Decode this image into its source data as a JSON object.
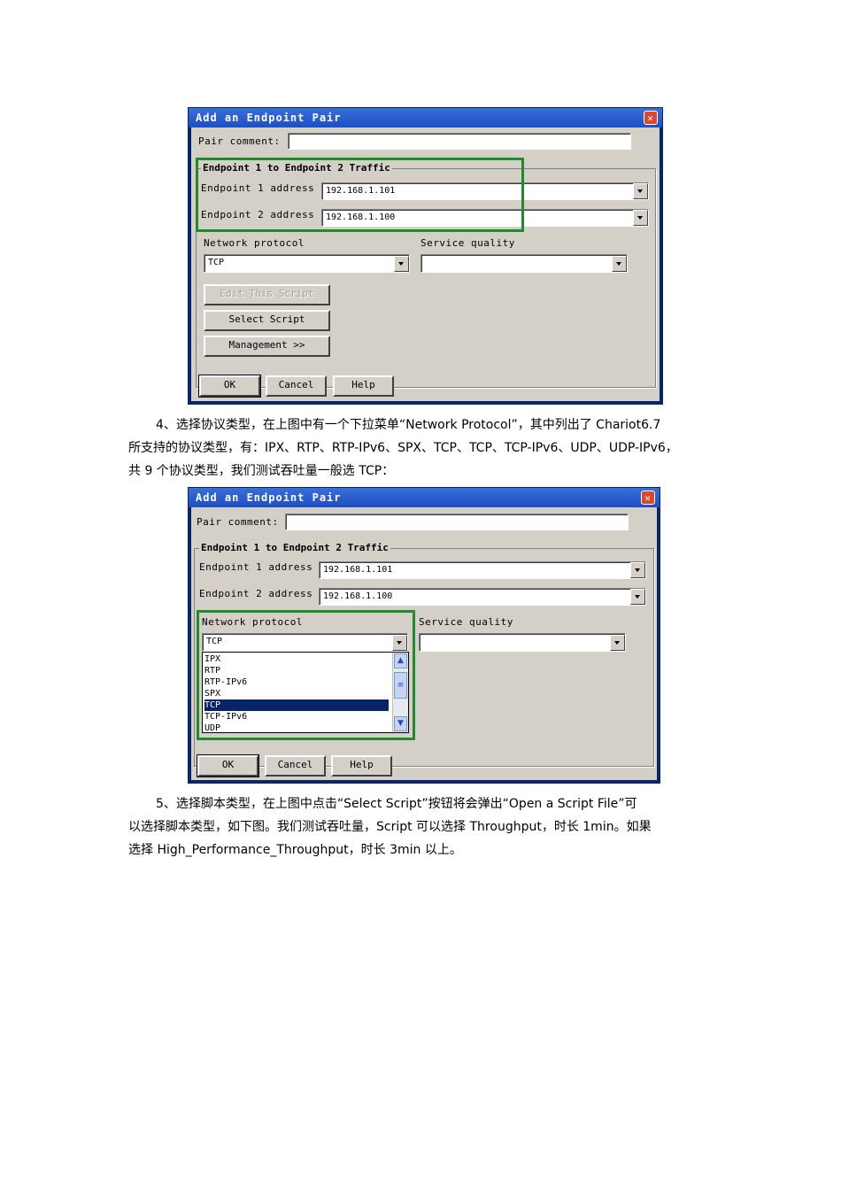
{
  "dialog1": {
    "title": "Add an Endpoint Pair",
    "pair_comment_label": "Pair comment:",
    "pair_comment_value": "",
    "group_title": "Endpoint 1 to Endpoint 2 Traffic",
    "ep1_label": "Endpoint 1 address",
    "ep1_value": "192.168.1.101",
    "ep2_label": "Endpoint 2 address",
    "ep2_value": "192.168.1.100",
    "protocol_label": "Network protocol",
    "protocol_value": "TCP",
    "quality_label": "Service quality",
    "quality_value": "",
    "edit_script": "Edit This Script",
    "select_script": "Select Script",
    "management": "Management >>",
    "ok": "OK",
    "cancel": "Cancel",
    "help": "Help"
  },
  "paragraph4": {
    "line1": "4、选择协议类型，在上图中有一个下拉菜单“Network Protocol”，其中列出了 Chariot6.7",
    "line2": "所支持的协议类型，有：IPX、RTP、RTP-IPv6、SPX、TCP、TCP、TCP-IPv6、UDP、UDP-IPv6，",
    "line3": "共 9 个协议类型，我们测试吞吐量一般选 TCP："
  },
  "dialog2": {
    "title": "Add an Endpoint Pair",
    "pair_comment_label": "Pair comment:",
    "group_title": "Endpoint 1 to Endpoint 2 Traffic",
    "ep1_label": "Endpoint 1 address",
    "ep1_value": "192.168.1.101",
    "ep2_label": "Endpoint 2 address",
    "ep2_value": "192.168.1.100",
    "protocol_label": "Network protocol",
    "protocol_value": "TCP",
    "quality_label": "Service quality",
    "protocol_options": [
      "IPX",
      "RTP",
      "RTP-IPv6",
      "SPX",
      "TCP",
      "TCP-IPv6",
      "UDP"
    ],
    "selected_option": "TCP",
    "ok": "OK",
    "cancel": "Cancel",
    "help": "Help"
  },
  "paragraph5": {
    "line1": "5、选择脚本类型，在上图中点击“Select Script”按钮将会弹出“Open a Script File”可",
    "line2": "以选择脚本类型，如下图。我们测试吞吐量，Script 可以选择 Throughput，时长 1min。如果",
    "line3": "选择 High_Performance_Throughput，时长 3min 以上。"
  },
  "colors": {
    "highlight_box": "#1f8a2e",
    "title_bar": "#1c4fc4",
    "dialog_face": "#d4d0c8"
  }
}
